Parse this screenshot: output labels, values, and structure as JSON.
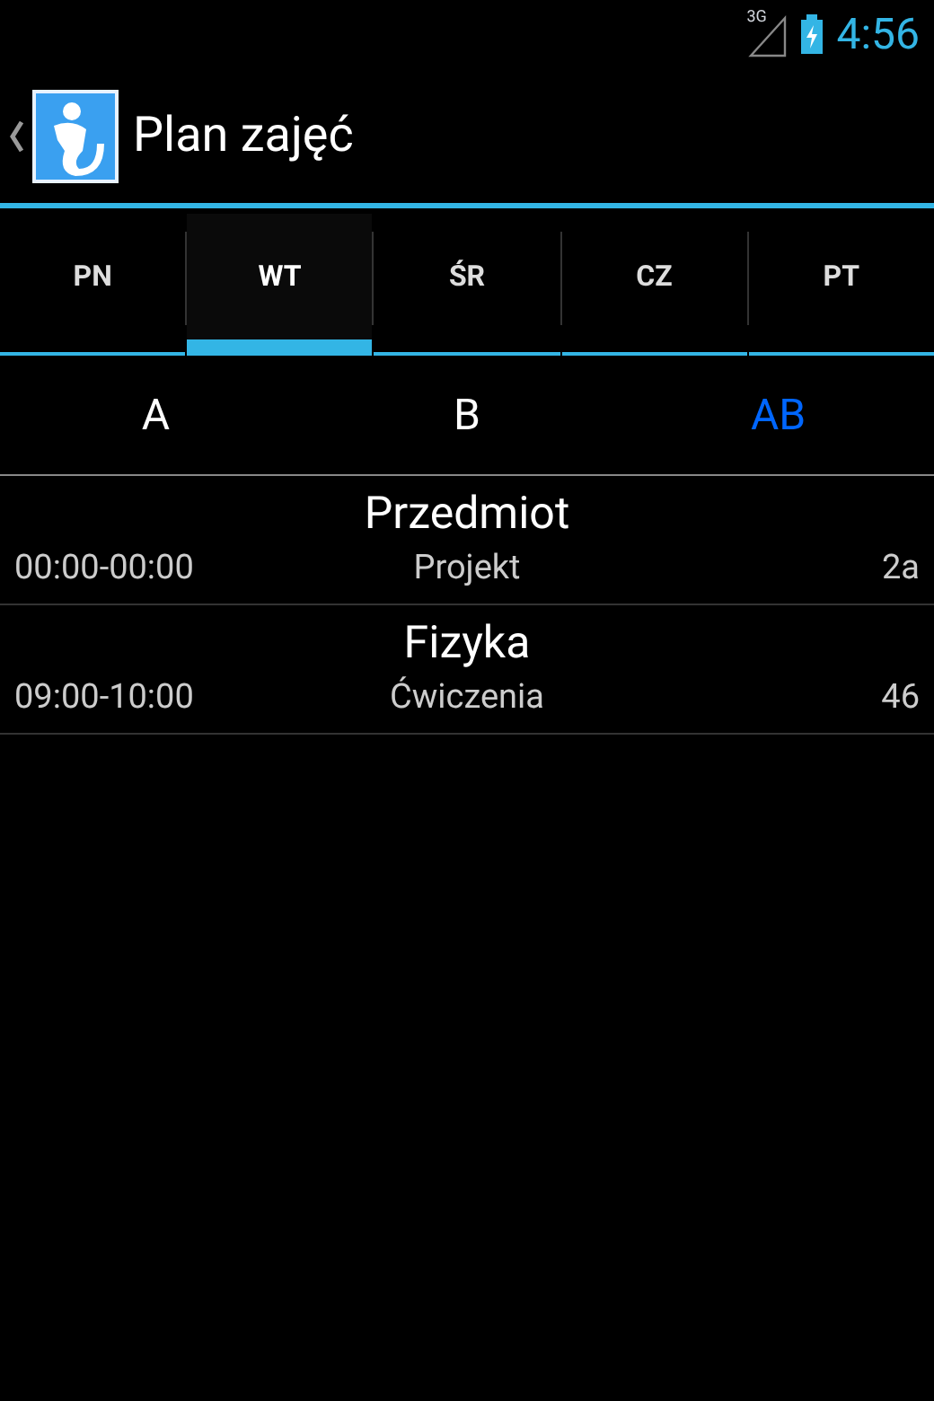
{
  "status_bar": {
    "network": "3G",
    "time": "4:56"
  },
  "action_bar": {
    "title": "Plan zajęć"
  },
  "tabs": [
    {
      "label": "PN",
      "selected": false
    },
    {
      "label": "WT",
      "selected": true
    },
    {
      "label": "ŚR",
      "selected": false
    },
    {
      "label": "CZ",
      "selected": false
    },
    {
      "label": "PT",
      "selected": false
    }
  ],
  "week_filter": [
    {
      "label": "A",
      "selected": false
    },
    {
      "label": "B",
      "selected": false
    },
    {
      "label": "AB",
      "selected": true
    }
  ],
  "classes": [
    {
      "subject": "Przedmiot",
      "time": "00:00-00:00",
      "type": "Projekt",
      "room": "2a"
    },
    {
      "subject": "Fizyka",
      "time": "09:00-10:00",
      "type": "Ćwiczenia",
      "room": "46"
    }
  ]
}
